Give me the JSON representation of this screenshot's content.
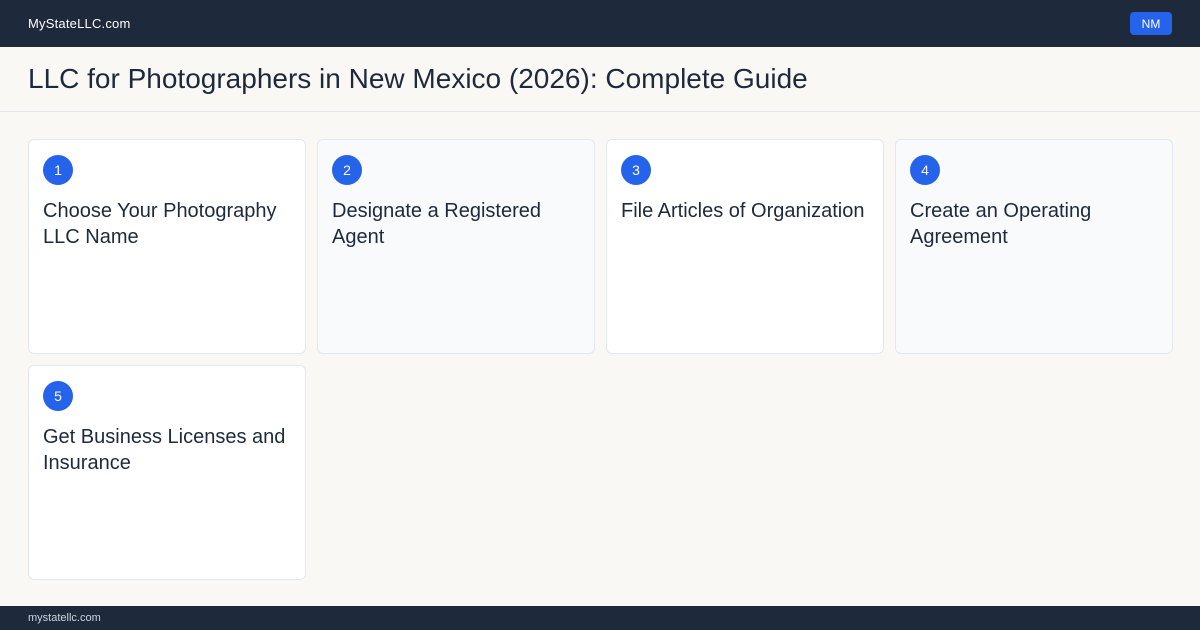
{
  "topbar": {
    "brand": "MyStateLLC.com",
    "state_badge": "NM"
  },
  "header": {
    "title": "LLC for Photographers  in New Mexico (2026): Complete Guide"
  },
  "steps": [
    {
      "number": "1",
      "title": "Choose Your Photography  LLC  Name"
    },
    {
      "number": "2",
      "title": "Designate a Registered Agent"
    },
    {
      "number": "3",
      "title": "File Articles  of Organization"
    },
    {
      "number": "4",
      "title": "Create an Operating Agreement"
    },
    {
      "number": "5",
      "title": "Get Business Licenses and Insurance"
    }
  ],
  "footer": {
    "url": "mystatellc.com"
  },
  "colors": {
    "navy": "#1e293b",
    "accent": "#2563eb",
    "page_background": "#f9f8f5"
  }
}
